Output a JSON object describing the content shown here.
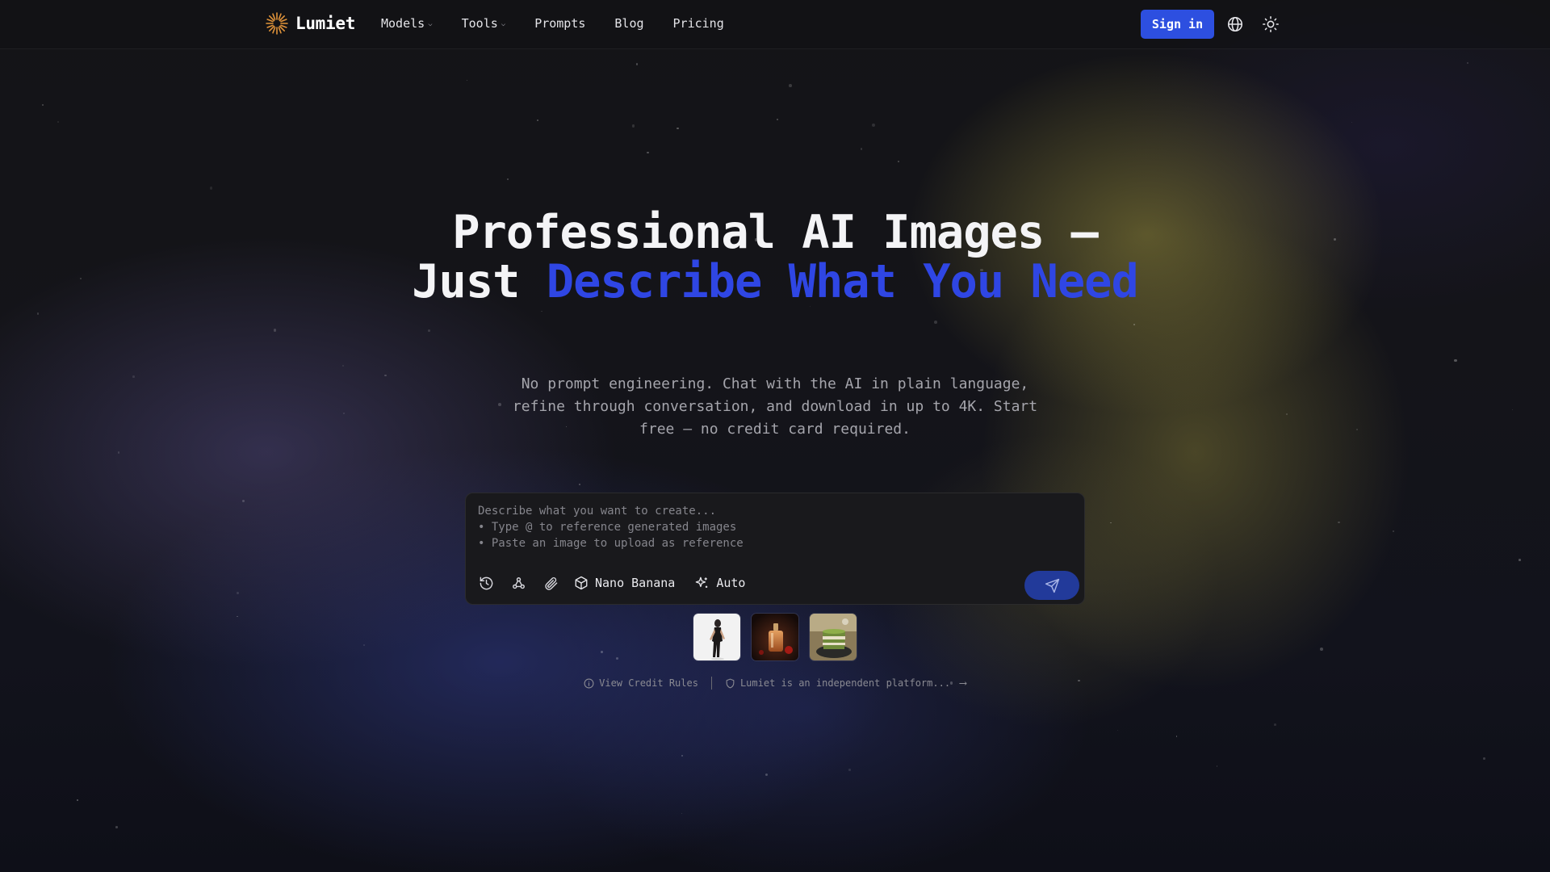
{
  "brand": {
    "name": "Lumiet",
    "logo_color": "#e0933a"
  },
  "nav": {
    "links": [
      {
        "label": "Models",
        "has_dropdown": true
      },
      {
        "label": "Tools",
        "has_dropdown": true
      },
      {
        "label": "Prompts",
        "has_dropdown": false
      },
      {
        "label": "Blog",
        "has_dropdown": false
      },
      {
        "label": "Pricing",
        "has_dropdown": false
      }
    ],
    "signin_label": "Sign in",
    "signin_color": "#2d4fe0",
    "icons": [
      "globe-icon",
      "sun-icon"
    ]
  },
  "hero": {
    "title_line1": "Professional AI Images —",
    "title_prefix": "Just ",
    "title_accent": "Describe What You Need",
    "accent_color": "#2f46e4",
    "subtitle": "No prompt engineering. Chat with the AI in plain language, refine through conversation, and download in up to 4K. Start free — no credit card required."
  },
  "prompt": {
    "placeholder": "Describe what you want to create...\n• Type @ to reference generated images\n• Paste an image to upload as reference",
    "value": "",
    "toolbar": {
      "icons": [
        "history-icon",
        "webhook-icon",
        "paperclip-icon"
      ],
      "model_label": "Nano Banana",
      "model_icon": "cube-icon",
      "mode_label": "Auto",
      "mode_icon": "sparkles-icon"
    },
    "send_icon": "send-icon"
  },
  "thumbnails": [
    {
      "name": "thumb-fashion-model"
    },
    {
      "name": "thumb-perfume-bottle"
    },
    {
      "name": "thumb-matcha-dessert"
    }
  ],
  "footer": {
    "credit_rules_label": "View Credit Rules",
    "disclaimer_label": "Lumiet is an independent platform...",
    "arrow": "⟶"
  }
}
